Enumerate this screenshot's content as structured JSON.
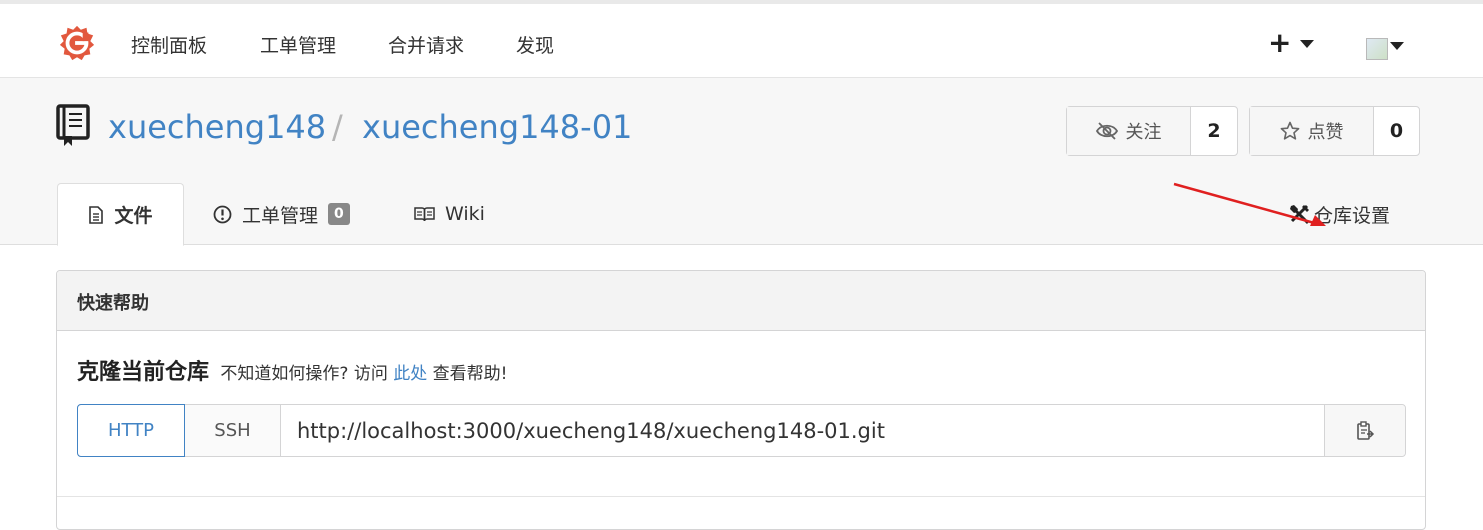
{
  "nav": {
    "items": [
      "控制面板",
      "工单管理",
      "合并请求",
      "发现"
    ]
  },
  "repo": {
    "owner": "xuecheng148",
    "separator": "/",
    "name": "xuecheng148-01",
    "watch": {
      "label": "关注",
      "count": "2"
    },
    "star": {
      "label": "点赞",
      "count": "0"
    }
  },
  "tabs": {
    "files": "文件",
    "issues": "工单管理",
    "issues_count": "0",
    "wiki": "Wiki",
    "settings": "仓库设置"
  },
  "quick_help": {
    "title": "快速帮助",
    "clone_title": "克隆当前仓库",
    "clone_hint_before": "不知道如何操作? 访问",
    "clone_hint_link": "此处",
    "clone_hint_after": "查看帮助!",
    "http_label": "HTTP",
    "ssh_label": "SSH",
    "clone_url": "http://localhost:3000/xuecheng148/xuecheng148-01.git"
  },
  "colors": {
    "link": "#4183c4",
    "logo": "#e2583e",
    "arrow": "#e02020"
  },
  "icons": [
    "gogs-logo",
    "plus-icon",
    "caret-down-icon",
    "avatar",
    "book-icon",
    "eye-slash-icon",
    "star-icon",
    "file-text-icon",
    "issue-opened-icon",
    "wiki-book-icon",
    "tools-icon",
    "copy-icon",
    "red-arrow"
  ]
}
